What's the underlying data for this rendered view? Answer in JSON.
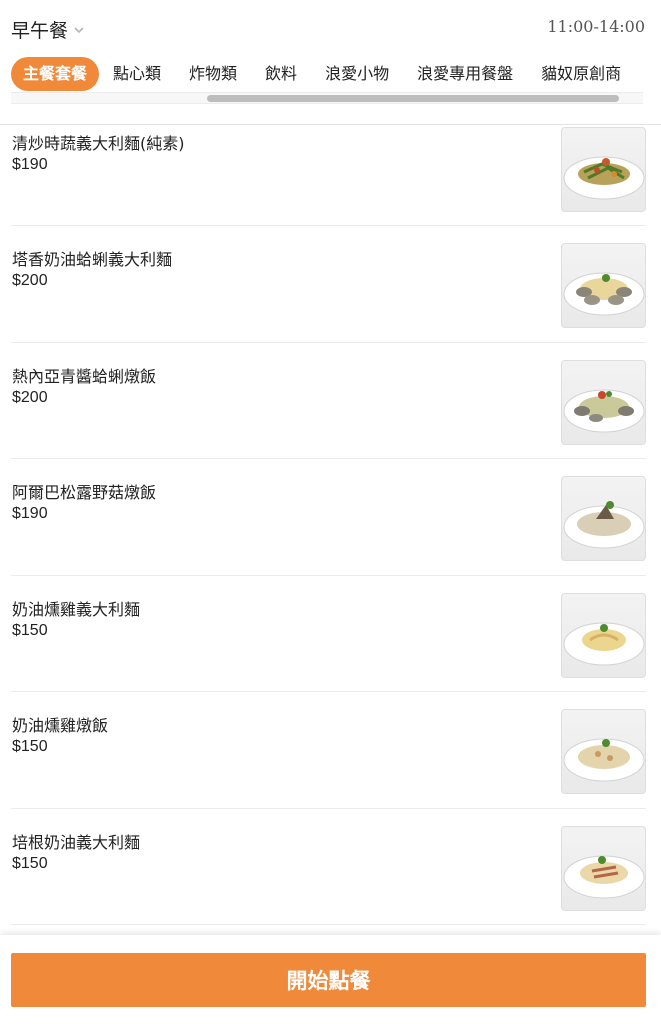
{
  "header": {
    "meal_period": "早午餐",
    "meal_period_icon": "chevron-down-icon",
    "hours": "11:00-14:00"
  },
  "tabs": [
    {
      "label": "主餐套餐",
      "active": true
    },
    {
      "label": "點心類",
      "active": false
    },
    {
      "label": "炸物類",
      "active": false
    },
    {
      "label": "飲料",
      "active": false
    },
    {
      "label": "浪愛小物",
      "active": false
    },
    {
      "label": "浪愛專用餐盤",
      "active": false
    },
    {
      "label": "貓奴原創商",
      "active": false
    }
  ],
  "menu_items": [
    {
      "name": "",
      "price": "",
      "photo": "plated-dish"
    },
    {
      "name": "清炒時蔬義大利麵(純素)",
      "price": "$190",
      "photo": "vegetable-pasta"
    },
    {
      "name": "塔香奶油蛤蜊義大利麵",
      "price": "$200",
      "photo": "clam-pasta"
    },
    {
      "name": "熱內亞青醬蛤蜊燉飯",
      "price": "$200",
      "photo": "pesto-clam-risotto"
    },
    {
      "name": "阿爾巴松露野菇燉飯",
      "price": "$190",
      "photo": "truffle-mushroom-risotto"
    },
    {
      "name": "奶油燻雞義大利麵",
      "price": "$150",
      "photo": "cream-chicken-pasta"
    },
    {
      "name": "奶油燻雞燉飯",
      "price": "$150",
      "photo": "cream-chicken-risotto"
    },
    {
      "name": "培根奶油義大利麵",
      "price": "$150",
      "photo": "bacon-cream-pasta"
    }
  ],
  "footer": {
    "start_label": "開始點餐"
  },
  "colors": {
    "accent": "#f0893a",
    "divider": "#ebebeb"
  }
}
